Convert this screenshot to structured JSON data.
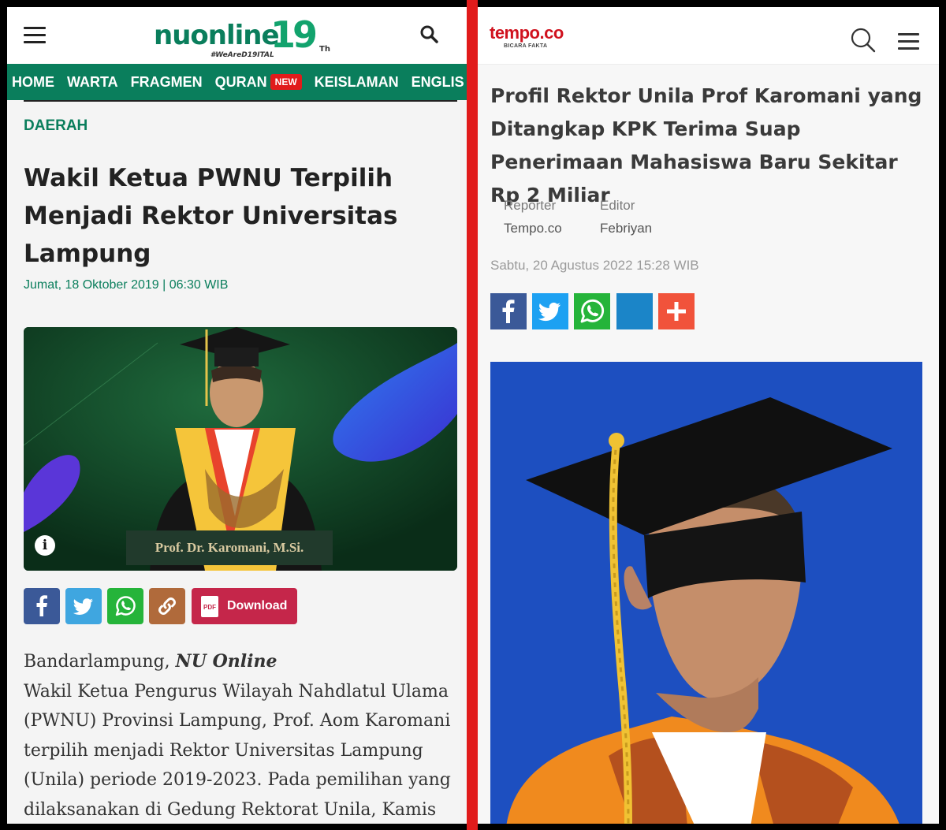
{
  "left": {
    "site": {
      "logo_word": "nuonline",
      "logo_anniversary": "19",
      "logo_suffix": "Th",
      "logo_tagline": "#WeAreD19ITAL"
    },
    "nav": {
      "items": [
        "HOME",
        "WARTA",
        "FRAGMEN",
        "QURAN",
        "KEISLAMAN",
        "ENGLIS"
      ],
      "new_badge": "NEW"
    },
    "article": {
      "category": "DAERAH",
      "title": "Wakil Ketua PWNU Terpilih Menjadi Rektor Universitas Lampung",
      "date": "Jumat, 18 Oktober 2019",
      "time": "06:30 WIB",
      "image_caption": "Prof. Dr. Karomani, M.Si.",
      "share": {
        "download_label": "Download",
        "pdf_label": "PDF"
      },
      "body_place": "Bandarlampung, ",
      "body_source": "NU Online",
      "body_text": "Wakil Ketua Pengurus Wilayah Nahdlatul Ulama (PWNU) Provinsi Lampung, Prof. Aom Karomani terpilih menjadi Rektor Universitas Lampung (Unila) periode 2019-2023. Pada pemilihan yang dilaksanakan di Gedung Rektorat Unila, Kamis"
    },
    "colors": {
      "brand_green": "#0a7e5c",
      "facebook": "#3b5998",
      "twitter": "#3fa6e0",
      "whatsapp": "#25b43a",
      "link": "#b06a3b",
      "download": "#c5264a"
    }
  },
  "right": {
    "site": {
      "logo": "tempo.co",
      "tagline": "BICARA FAKTA"
    },
    "article": {
      "title": "Profil Rektor Unila Prof Karomani yang Ditangkap KPK Terima Suap Penerimaan Mahasiswa Baru Sekitar Rp 2 Miliar",
      "reporter_label": "Reporter",
      "reporter": "Tempo.co",
      "editor_label": "Editor",
      "editor": "Febriyan",
      "date": "Sabtu, 20 Agustus 2022 15:28 WIB"
    },
    "colors": {
      "brand_red": "#d0121e",
      "facebook": "#3b5998",
      "twitter": "#1da1f2",
      "whatsapp": "#25b43a",
      "generic": "#1b85c8",
      "more": "#f1533b",
      "photo_bg": "#1d4fc0"
    }
  }
}
